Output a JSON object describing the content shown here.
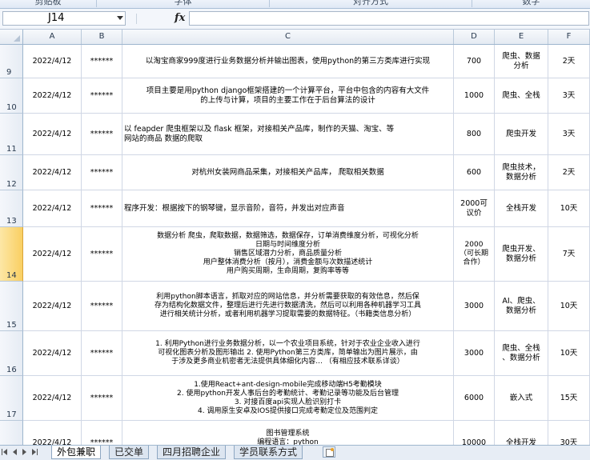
{
  "ribbon": {
    "groups": [
      "剪贴板",
      "字体",
      "对齐方式",
      "数字"
    ]
  },
  "formula_bar": {
    "name_box": "J14",
    "fx_label": "fx",
    "formula": ""
  },
  "columns": [
    "A",
    "B",
    "C",
    "D",
    "E",
    "F"
  ],
  "rows": [
    {
      "num": "9",
      "date": "2022/4/12",
      "mask": "******",
      "desc": "以淘宝商家999度进行业务数据分析并输出图表，使用python的第三方类库进行实现",
      "price": "700",
      "type": "爬虫、数据\n分析",
      "days": "2天"
    },
    {
      "num": "10",
      "date": "2022/4/12",
      "mask": "******",
      "desc": "项目主要是用python django框架搭建的一个计算平台，平台中包含的内容有大文件\n的上传与计算，项目的主要工作在于后台算法的设计",
      "price": "1000",
      "type": "爬虫、全栈",
      "days": "3天"
    },
    {
      "num": "11",
      "date": "2022/4/12",
      "mask": "******",
      "desc": "以 feapder 爬虫框架以及 flask 框架，对接相关产品库，制作的天猫、淘宝、等\n网站的商品 数据的爬取",
      "price": "800",
      "type": "爬虫开发",
      "days": "3天"
    },
    {
      "num": "12",
      "date": "2022/4/12",
      "mask": "******",
      "desc": "对杭州女装网商品采集，对接相关产品库， 爬取相关数据",
      "price": "600",
      "type": "爬虫技术，\n数据分析",
      "days": "2天"
    },
    {
      "num": "13",
      "date": "2022/4/12",
      "mask": "******",
      "desc": "程序开发：根据按下的钢琴键，显示音阶，音符，并发出对应声音",
      "price": "2000可\n议价",
      "type": "全栈开发",
      "days": "10天"
    },
    {
      "num": "14",
      "date": "2022/4/12",
      "mask": "******",
      "desc": "数据分析 爬虫，爬取数据，数据筛选，数据保存，订单消费维度分析，可视化分析\n日期与时间维度分析\n销售区域潜力分析，商品质量分析\n用户整体消费分析（按月），消费金额与次数描述统计\n用户购买周期，生命周期，复购率等等",
      "price": "2000\n（可长期\n合作）",
      "type": "爬虫开发、\n数据分析",
      "days": "7天"
    },
    {
      "num": "15",
      "date": "2022/4/12",
      "mask": "******",
      "desc": "利用python脚本语言，抓取对应的网站信息，并分析需要获取的有效信息，然后保\n存为结构化数据文件，整理后进行先进行数据清洗，然后可以利用各种机器学习工具\n进行相关统计分析，或者利用机器学习提取需要的数据特征。（书籍类信息分析）",
      "price": "3000",
      "type": "AI、爬虫、\n数据分析",
      "days": "10天"
    },
    {
      "num": "16",
      "date": "2022/4/12",
      "mask": "******",
      "desc": "1. 利用Python进行业务数据分析，以一个农业项目系统，针对于农业企业收入进行\n可视化图表分析及图形输出 2. 使用Python第三方类库，简单输出为图片展示，由\n于涉及更多商业机密者无法提供具体细化内容... （有相应技术联系详谈）",
      "price": "3000",
      "type": "爬虫、全栈\n、数据分析",
      "days": "10天"
    },
    {
      "num": "17",
      "date": "2022/4/12",
      "mask": "******",
      "desc": "1.使用React+ant-design-mobile完成移动端H5考勤模块\n2. 使用python开发人事后台的考勤统计、考勤记录等功能及后台管理\n3. 对接百度api实现人脸识别打卡\n4. 调用原生安卓及IOS提供接口完成考勤定位及范围判定",
      "price": "6000",
      "type": "嵌入式",
      "days": "15天"
    },
    {
      "num": "18",
      "date": "2022/4/12",
      "mask": "******",
      "desc": "图书管理系统\n编程语言：python\n功能：专注于图书管理的社交平台。",
      "price": "10000",
      "type": "全栈开发",
      "days": "30天"
    }
  ],
  "active_row": "14",
  "sheet_tabs": [
    "外包兼职",
    "已交单",
    "四月招聘企业",
    "学员联系方式"
  ],
  "active_tab": "外包兼职"
}
